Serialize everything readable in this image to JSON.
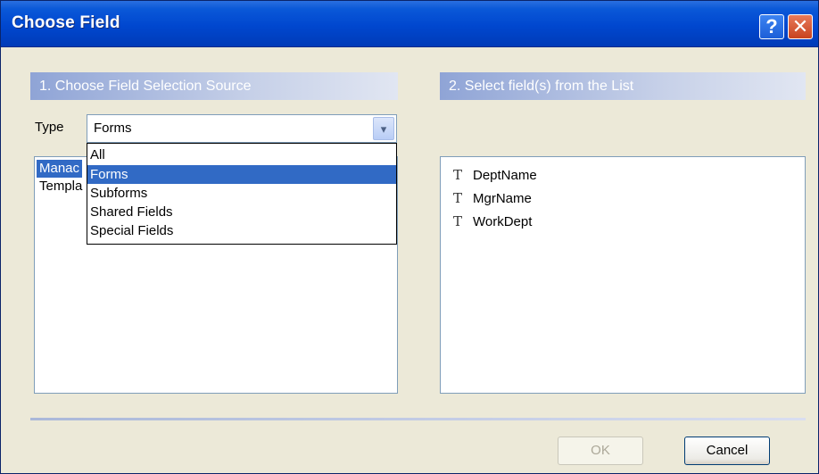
{
  "window": {
    "title": "Choose Field",
    "help_label": "?",
    "close_label": "✕"
  },
  "section1": {
    "header": "1. Choose Field Selection Source",
    "type_label": "Type",
    "type_value": "Forms",
    "dropdown_arrow": "▾",
    "dropdown_options": [
      "All",
      "Forms",
      "Subforms",
      "Shared Fields",
      "Special Fields"
    ],
    "selected_option": "Forms",
    "list_items": [
      {
        "label": "Manac",
        "selected": true
      },
      {
        "label": "Templa",
        "selected": false
      }
    ]
  },
  "section2": {
    "header": "2. Select field(s) from the List",
    "field_icon": "T",
    "fields": [
      "DeptName",
      "MgrName",
      "WorkDept"
    ]
  },
  "buttons": {
    "ok": "OK",
    "cancel": "Cancel",
    "ok_enabled": false
  }
}
